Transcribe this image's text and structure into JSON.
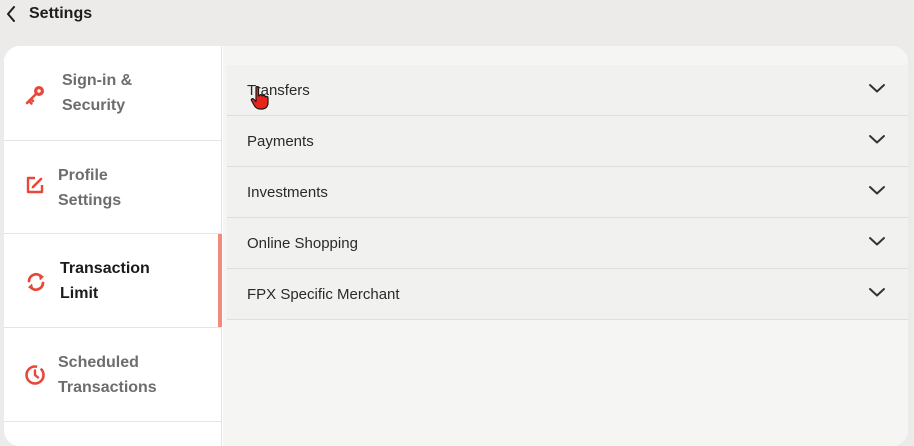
{
  "header": {
    "title": "Settings",
    "back_icon": "chevron-left-icon"
  },
  "colors": {
    "accent": "#e8483a",
    "active_indicator": "#f28a7e",
    "background": "#ecebea"
  },
  "sidebar": {
    "items": [
      {
        "label_line1": "Sign-in &",
        "label_line2": "Security",
        "icon": "key-icon",
        "active": false
      },
      {
        "label_line1": "Profile",
        "label_line2": "Settings",
        "icon": "edit-icon",
        "active": false
      },
      {
        "label_line1": "Transaction",
        "label_line2": "Limit",
        "icon": "sync-arrows-icon",
        "active": true
      },
      {
        "label_line1": "Scheduled",
        "label_line2": "Transactions",
        "icon": "timer-icon",
        "active": false
      }
    ]
  },
  "main": {
    "sections": [
      {
        "label": "Transfers",
        "icon": "chevron-down-icon"
      },
      {
        "label": "Payments",
        "icon": "chevron-down-icon"
      },
      {
        "label": "Investments",
        "icon": "chevron-down-icon"
      },
      {
        "label": "Online Shopping",
        "icon": "chevron-down-icon"
      },
      {
        "label": "FPX Specific Merchant",
        "icon": "chevron-down-icon"
      }
    ]
  }
}
